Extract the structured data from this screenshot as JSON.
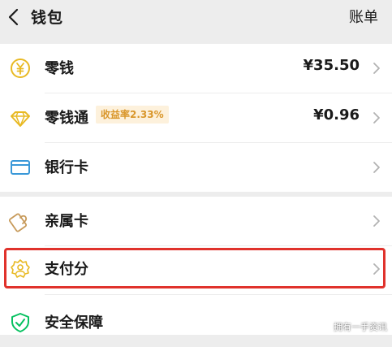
{
  "header": {
    "title": "钱包",
    "bill_label": "账单"
  },
  "group1": {
    "items": [
      {
        "label": "零钱",
        "value": "¥35.50",
        "icon": "yuan-coin-icon"
      },
      {
        "label": "零钱通",
        "value": "¥0.96",
        "badge": "收益率2.33%",
        "icon": "diamond-icon"
      },
      {
        "label": "银行卡",
        "value": "",
        "icon": "bank-card-icon"
      }
    ]
  },
  "group2": {
    "items": [
      {
        "label": "亲属卡",
        "icon": "family-card-icon"
      },
      {
        "label": "支付分",
        "icon": "pay-score-icon",
        "highlighted": true
      },
      {
        "label": "安全保障",
        "icon": "shield-check-icon"
      }
    ]
  },
  "watermark": "拥有一手资讯",
  "colors": {
    "accent_green": "#07c160",
    "coin_yellow": "#e8b923",
    "card_blue": "#3a98d8",
    "badge_text": "#d9962a",
    "badge_bg": "#fdf1dc",
    "highlight_red": "#e0322c"
  }
}
